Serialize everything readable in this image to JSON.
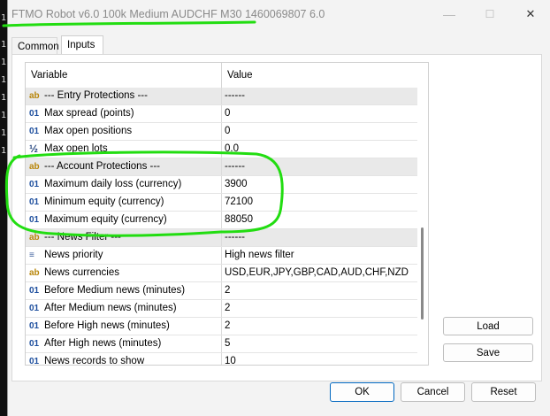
{
  "window": {
    "title": "FTMO Robot v6.0 100k Medium AUDCHF M30 1460069807 6.0",
    "controls": {
      "minimize": "—",
      "maximize": "☐",
      "close": "✕"
    }
  },
  "tabs": [
    {
      "label": "Common"
    },
    {
      "label": "Inputs"
    }
  ],
  "table": {
    "headers": {
      "variable": "Variable",
      "value": "Value"
    },
    "rows": [
      {
        "type": "str",
        "icon": "ab",
        "group": true,
        "variable": "--- Entry Protections ---",
        "value": "------"
      },
      {
        "type": "int",
        "icon": "01",
        "variable": "Max spread (points)",
        "value": "0"
      },
      {
        "type": "int",
        "icon": "01",
        "variable": "Max open positions",
        "value": "0"
      },
      {
        "type": "dbl",
        "icon": "½",
        "variable": "Max open lots",
        "value": "0.0"
      },
      {
        "type": "str",
        "icon": "ab",
        "group": true,
        "variable": "--- Account Protections ---",
        "value": "------"
      },
      {
        "type": "int",
        "icon": "01",
        "variable": "Maximum daily loss (currency)",
        "value": "3900"
      },
      {
        "type": "int",
        "icon": "01",
        "variable": "Minimum equity (currency)",
        "value": "72100"
      },
      {
        "type": "int",
        "icon": "01",
        "variable": "Maximum equity (currency)",
        "value": "88050"
      },
      {
        "type": "str",
        "icon": "ab",
        "group": true,
        "variable": "--- News Filter ---",
        "value": "------"
      },
      {
        "type": "enum",
        "icon": "≡",
        "variable": "News priority",
        "value": "High news filter"
      },
      {
        "type": "str",
        "icon": "ab",
        "variable": "News currencies",
        "value": "USD,EUR,JPY,GBP,CAD,AUD,CHF,NZD"
      },
      {
        "type": "int",
        "icon": "01",
        "variable": "Before Medium news (minutes)",
        "value": "2"
      },
      {
        "type": "int",
        "icon": "01",
        "variable": "After Medium news (minutes)",
        "value": "2"
      },
      {
        "type": "int",
        "icon": "01",
        "variable": "Before High news (minutes)",
        "value": "2"
      },
      {
        "type": "int",
        "icon": "01",
        "variable": "After High news (minutes)",
        "value": "5"
      },
      {
        "type": "int",
        "icon": "01",
        "variable": "News records to show",
        "value": "10"
      }
    ]
  },
  "side_buttons": {
    "load": "Load",
    "save": "Save"
  },
  "footer": {
    "ok": "OK",
    "cancel": "Cancel",
    "reset": "Reset"
  },
  "background_chars": [
    "1",
    "1",
    "1",
    "1",
    "1",
    "1",
    "1",
    "1"
  ],
  "colors": {
    "annotation": "#22dd11",
    "primary_border": "#0067c0"
  }
}
